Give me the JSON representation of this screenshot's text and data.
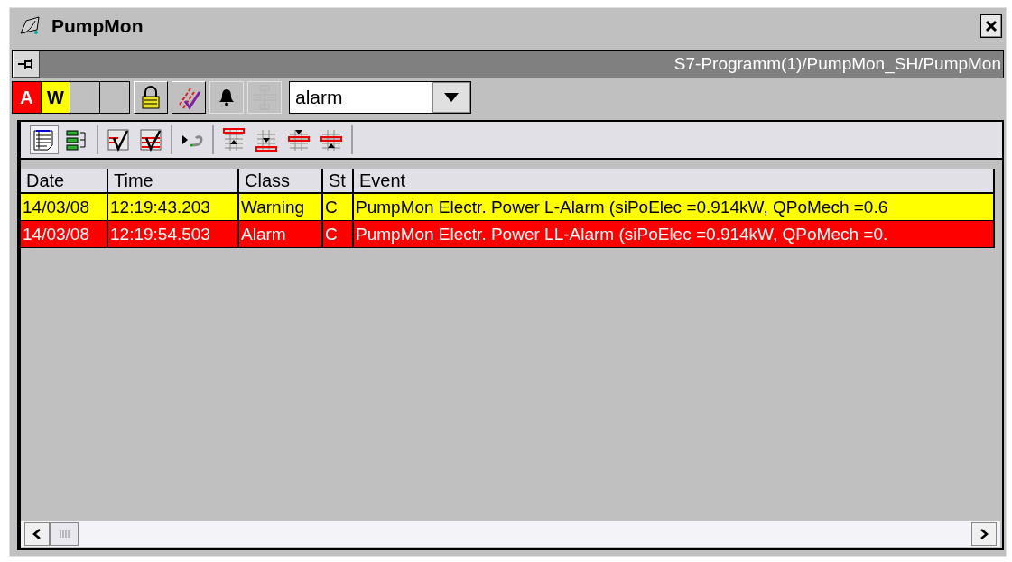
{
  "window": {
    "title": "PumpMon"
  },
  "path": "S7-Programm(1)/PumpMon_SH/PumpMon",
  "indicators": [
    {
      "label": "A",
      "color": "#ff0000"
    },
    {
      "label": "W",
      "color": "#ffff00"
    }
  ],
  "tools": [
    {
      "kind": "lock",
      "disabled": false
    },
    {
      "kind": "acknowledge",
      "disabled": false
    },
    {
      "kind": "bell",
      "disabled": false
    },
    {
      "kind": "filter",
      "disabled": true
    }
  ],
  "filter": {
    "value": "alarm"
  },
  "view_tools": [
    {
      "items": [
        {
          "kind": "list",
          "selected": true
        },
        {
          "kind": "tree",
          "selected": false
        }
      ]
    },
    {
      "items": [
        {
          "kind": "ack",
          "selected": false
        },
        {
          "kind": "ack-all",
          "selected": false
        }
      ]
    },
    {
      "items": [
        {
          "kind": "loop",
          "selected": false
        }
      ]
    },
    {
      "items": [
        {
          "kind": "top",
          "selected": false
        },
        {
          "kind": "down",
          "selected": false
        },
        {
          "kind": "bottom",
          "selected": false
        },
        {
          "kind": "up",
          "selected": false
        }
      ]
    }
  ],
  "table": {
    "columns": [
      "Date",
      "Time",
      "Class",
      "St",
      "Event"
    ],
    "rows": [
      {
        "kind": "warning",
        "cells": [
          "14/03/08",
          "12:19:43.203",
          "Warning",
          "C",
          "PumpMon Electr. Power L-Alarm (siPoElec =0.914kW, QPoMech =0.6"
        ]
      },
      {
        "kind": "alarm",
        "cells": [
          "14/03/08",
          "12:19:54.503",
          "Alarm",
          "C",
          "PumpMon Electr. Power LL-Alarm (siPoElec =0.914kW, QPoMech =0."
        ]
      }
    ]
  }
}
